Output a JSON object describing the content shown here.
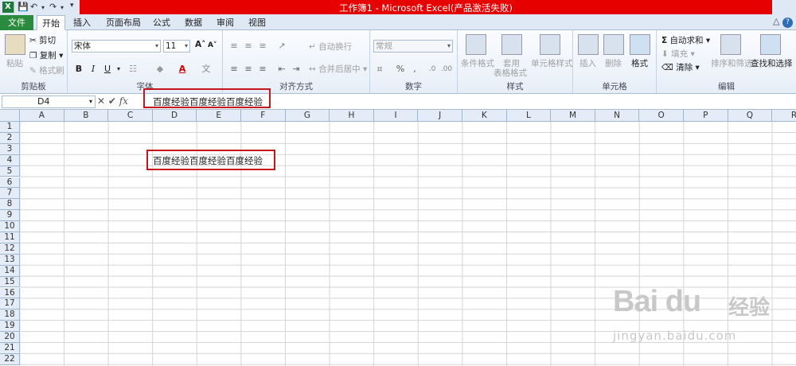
{
  "window": {
    "title": "工作簿1 - Microsoft Excel(产品激活失败)",
    "app_icon": "X"
  },
  "tabs": {
    "file": "文件",
    "items": [
      "开始",
      "插入",
      "页面布局",
      "公式",
      "数据",
      "审阅",
      "视图"
    ],
    "active": "开始"
  },
  "ribbon": {
    "clipboard": {
      "label": "剪贴板",
      "paste": "粘贴",
      "cut": "剪切",
      "copy": "复制",
      "format_painter": "格式刷"
    },
    "font": {
      "label": "字体",
      "name": "宋体",
      "size": "11"
    },
    "alignment": {
      "label": "对齐方式",
      "wrap": "自动换行",
      "merge": "合并后居中"
    },
    "number": {
      "label": "数字",
      "format": "常规"
    },
    "styles": {
      "label": "样式",
      "conditional": "条件格式",
      "table_1": "套用",
      "table_2": "表格格式",
      "cell_styles": "单元格样式"
    },
    "cells": {
      "label": "单元格",
      "insert": "插入",
      "delete": "删除",
      "format": "格式"
    },
    "editing": {
      "label": "编辑",
      "autosum": "自动求和",
      "fill": "填充",
      "clear": "清除",
      "sort_filter": "排序和筛选",
      "find_select": "查找和选择"
    }
  },
  "formula_bar": {
    "name_box": "D4",
    "content": "百度经验百度经验百度经验"
  },
  "sheet": {
    "columns": [
      "A",
      "B",
      "C",
      "D",
      "E",
      "F",
      "G",
      "H",
      "I",
      "J",
      "K",
      "L",
      "M",
      "N",
      "O",
      "P",
      "Q",
      "R"
    ],
    "rows": [
      "1",
      "2",
      "3",
      "4",
      "5",
      "6",
      "7",
      "8",
      "9",
      "10",
      "11",
      "12",
      "13",
      "14",
      "15",
      "16",
      "17",
      "18",
      "19",
      "20",
      "21",
      "22"
    ],
    "d4_value": "百度经验百度经验百度经验"
  },
  "watermark": {
    "logo": "Bai du",
    "cn": "经验",
    "url": "jingyan.baidu.com"
  },
  "colors": {
    "title_red": "#e60000",
    "file_green": "#2a8a3e",
    "highlight": "#c4161c"
  }
}
